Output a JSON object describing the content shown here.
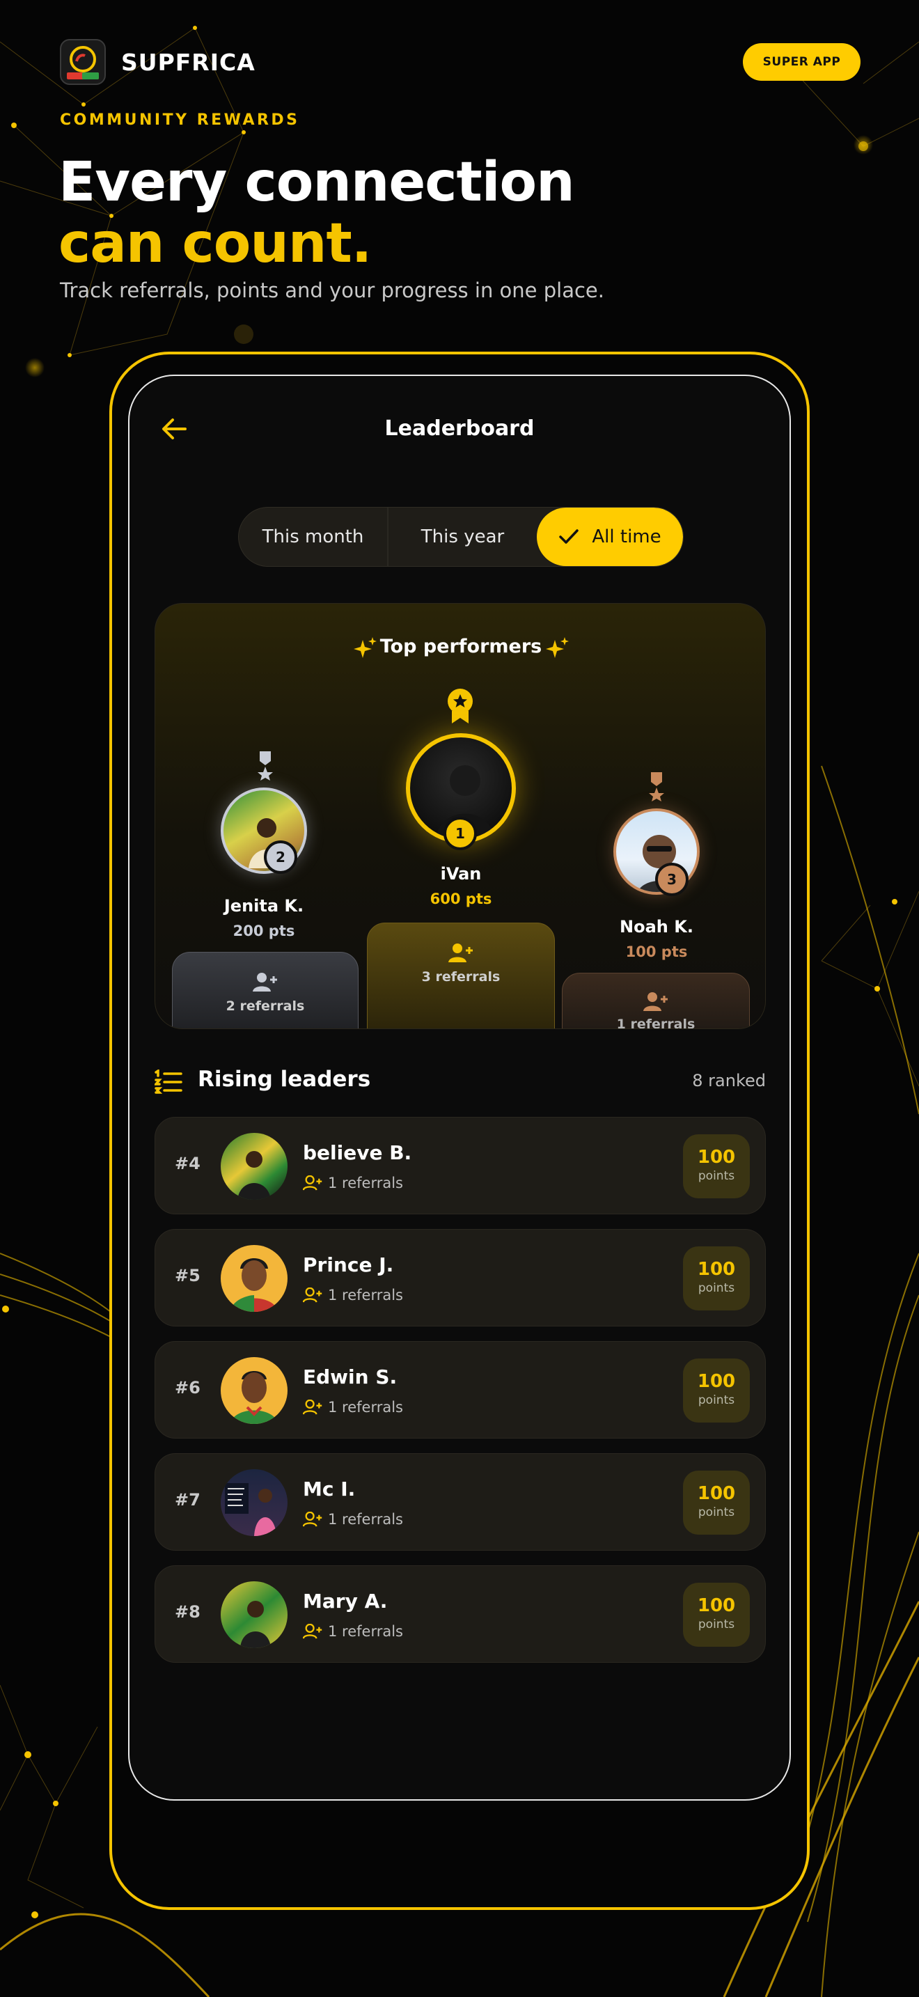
{
  "header": {
    "brand_name": "SUPFRICA",
    "super_app_label": "SUPER APP",
    "eyebrow": "COMMUNITY REWARDS",
    "hero_line1": "Every connection",
    "hero_line2": "can count.",
    "subtitle": "Track referrals, points and your progress in one place."
  },
  "leaderboard": {
    "title": "Leaderboard",
    "filters": [
      "This month",
      "This year",
      "All time"
    ],
    "selected_filter": "All time"
  },
  "top_performers": {
    "title": "Top performers",
    "podium": [
      {
        "rank": "2",
        "name": "Jenita K.",
        "points": "200 pts",
        "referrals": "2 referrals"
      },
      {
        "rank": "1",
        "name": "iVan",
        "points": "600 pts",
        "referrals": "3 referrals"
      },
      {
        "rank": "3",
        "name": "Noah K.",
        "points": "100 pts",
        "referrals": "1 referrals"
      }
    ]
  },
  "rising_leaders": {
    "title": "Rising leaders",
    "count_label": "8 ranked",
    "rows": [
      {
        "rank": "#4",
        "name": "believe B.",
        "referrals": "1 referrals",
        "points": "100",
        "points_label": "points"
      },
      {
        "rank": "#5",
        "name": "Prince J.",
        "referrals": "1 referrals",
        "points": "100",
        "points_label": "points"
      },
      {
        "rank": "#6",
        "name": "Edwin S.",
        "referrals": "1 referrals",
        "points": "100",
        "points_label": "points"
      },
      {
        "rank": "#7",
        "name": "Mc I.",
        "referrals": "1 referrals",
        "points": "100",
        "points_label": "points"
      },
      {
        "rank": "#8",
        "name": "Mary A.",
        "referrals": "1 referrals",
        "points": "100",
        "points_label": "points"
      }
    ]
  },
  "colors": {
    "accent": "#F5C400",
    "button": "#FFCC00",
    "bronze": "#C98A5C",
    "silver": "#C8CCD6",
    "card": "#1E1C17"
  },
  "icons": [
    "logo-icon",
    "back-arrow-icon",
    "check-icon",
    "sparkle-icon",
    "medal-icon",
    "add-user-icon",
    "list-icon"
  ]
}
